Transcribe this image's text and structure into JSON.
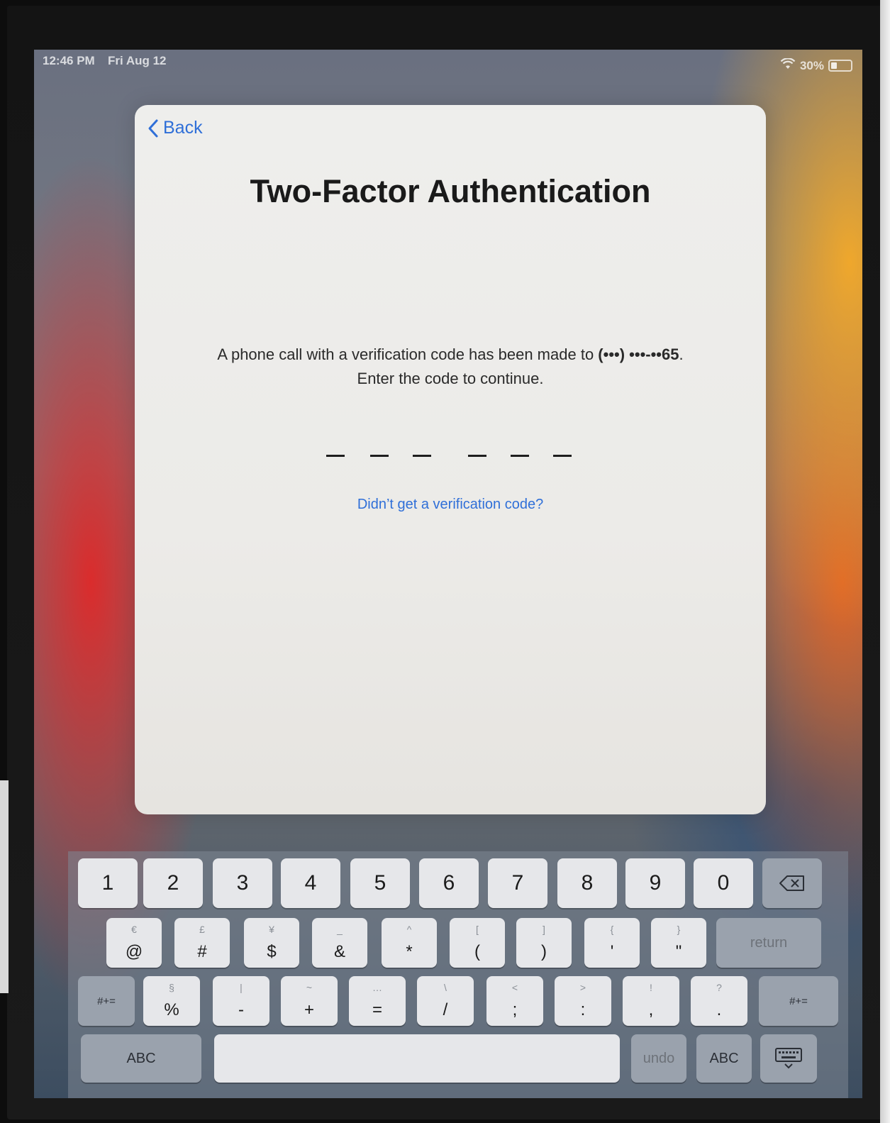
{
  "status_bar": {
    "time": "12:46 PM",
    "date": "Fri Aug 12",
    "battery_text": "30%",
    "battery_level": 0.3,
    "wifi_icon": "wifi-icon"
  },
  "dialog": {
    "back_label": "Back",
    "title": "Two-Factor Authentication",
    "message_prefix": "A phone call with a verification code has been made to ",
    "phone_masked": "(•••) •••-••65",
    "message_end": ".",
    "message_line2": "Enter the code to continue.",
    "code_digits": [
      "",
      "",
      "",
      "",
      "",
      ""
    ],
    "resend_link": "Didn’t get a verification code?"
  },
  "keyboard": {
    "row1": [
      "1",
      "2",
      "3",
      "4",
      "5",
      "6",
      "7",
      "8",
      "9",
      "0"
    ],
    "backspace_icon": "backspace-icon",
    "row2": [
      {
        "alt": "€",
        "main": "@"
      },
      {
        "alt": "£",
        "main": "#"
      },
      {
        "alt": "¥",
        "main": "$"
      },
      {
        "alt": "_",
        "main": "&"
      },
      {
        "alt": "^",
        "main": "*"
      },
      {
        "alt": "[",
        "main": "("
      },
      {
        "alt": "]",
        "main": ")"
      },
      {
        "alt": "{",
        "main": "'"
      },
      {
        "alt": "}",
        "main": "\""
      }
    ],
    "return_label": "return",
    "row3_left": "#+=",
    "row3": [
      {
        "alt": "§",
        "main": "%"
      },
      {
        "alt": "|",
        "main": "-"
      },
      {
        "alt": "~",
        "main": "+"
      },
      {
        "alt": "…",
        "main": "="
      },
      {
        "alt": "\\",
        "main": "/"
      },
      {
        "alt": "<",
        "main": ";"
      },
      {
        "alt": ">",
        "main": ":"
      },
      {
        "alt": "!",
        "main": ","
      },
      {
        "alt": "?",
        "main": "."
      }
    ],
    "row3_right": "#+=",
    "abc_left": "ABC",
    "undo_label": "undo",
    "abc_right": "ABC",
    "dismiss_icon": "keyboard-dismiss-icon"
  }
}
